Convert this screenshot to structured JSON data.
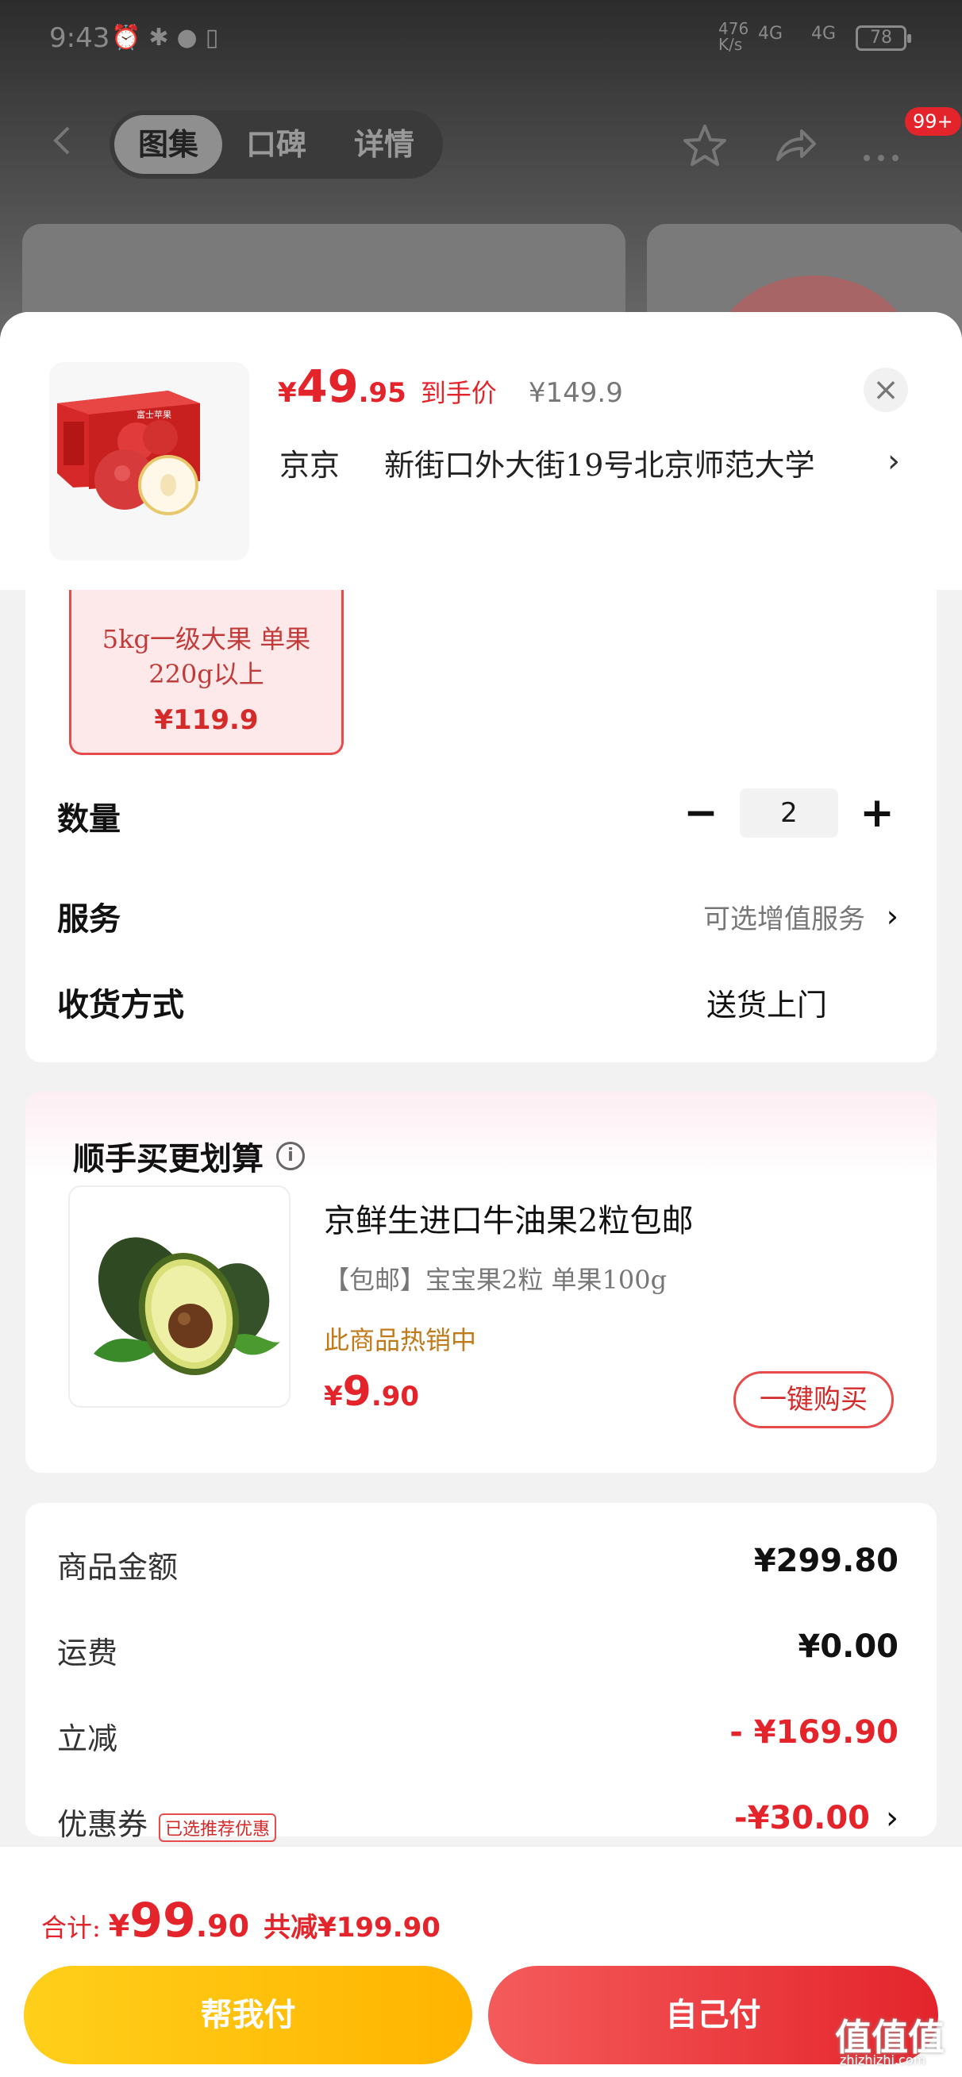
{
  "status_bar": {
    "time": "9:43",
    "net_speed_top": "476",
    "net_speed_unit": "K/s",
    "signal1_label": "4G",
    "signal2_label": "4G",
    "battery": "78"
  },
  "nav": {
    "tabs": [
      "图集",
      "口碑",
      "详情"
    ],
    "active_tab": "图集",
    "badge": "99+"
  },
  "sheet": {
    "price_currency": "¥",
    "price_int": "49",
    "price_dec": ".95",
    "price_tag": "到手价",
    "original_price": "¥149.9",
    "city": "京京",
    "address": "新街口外大街19号北京师范大学",
    "product_box_text": "富士苹果"
  },
  "spec": {
    "label": "5kg一级大果 单果220g以上",
    "price": "¥119.9"
  },
  "rows": {
    "quantity_label": "数量",
    "quantity_value": "2",
    "minus": "−",
    "plus": "+",
    "service_label": "服务",
    "service_value": "可选增值服务",
    "delivery_label": "收货方式",
    "delivery_value": "送货上门"
  },
  "upsell": {
    "title": "顺手买更划算",
    "name": "京鲜生进口牛油果2粒包邮",
    "sub": "【包邮】宝宝果2粒 单果100g",
    "hot": "此商品热销中",
    "price_cur": "¥",
    "price_int": "9",
    "price_dec": ".90",
    "buy_label": "一键购买"
  },
  "fees": {
    "goods_label": "商品金额",
    "goods_value": "¥299.80",
    "shipping_label": "运费",
    "shipping_value": "¥0.00",
    "discount_label": "立减",
    "discount_value": "- ¥169.90",
    "coupon_label": "优惠券",
    "coupon_tag": "已选推荐优惠",
    "coupon_value": "-¥30.00"
  },
  "footer": {
    "total_label": "合计:",
    "total_cur": "¥",
    "total_int": "99",
    "total_dec": ".90",
    "saved": "共减¥199.90",
    "help_pay": "帮我付",
    "self_pay": "自己付"
  },
  "watermark": {
    "logo": "值值值",
    "site": "zhizhizhi.com"
  },
  "colors": {
    "accent_red": "#e3242b",
    "help_yellow": "#ffb400"
  }
}
